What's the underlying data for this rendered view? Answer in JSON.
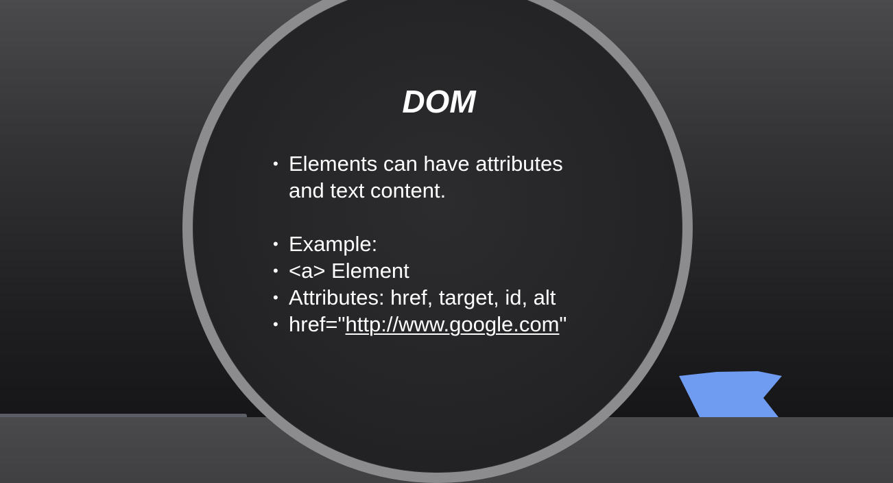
{
  "slide": {
    "title": "DOM",
    "bullets": {
      "b1_line1": "Elements can have attributes",
      "b1_line2": "and text content.",
      "b2": "Example:",
      "b3": "<a> Element",
      "b4": "Attributes: href, target, id, alt",
      "b5_prefix": "href=\"",
      "b5_link": "http://www.google.com",
      "b5_suffix": "\""
    }
  },
  "colors": {
    "background": "#333335",
    "ring": "#8c8c8e",
    "text": "#ffffff",
    "accent_shape": "#6f9bf0"
  }
}
